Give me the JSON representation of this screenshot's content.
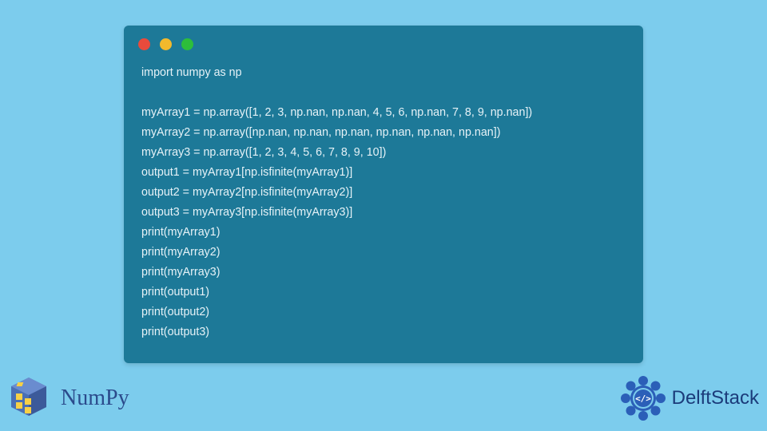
{
  "code": {
    "line1": "import numpy as np",
    "blank": "",
    "line2": "myArray1 = np.array([1, 2, 3, np.nan, np.nan, 4, 5, 6, np.nan, 7, 8, 9, np.nan])",
    "line3": "myArray2 = np.array([np.nan, np.nan, np.nan, np.nan, np.nan, np.nan])",
    "line4": "myArray3 = np.array([1, 2, 3, 4, 5, 6, 7, 8, 9, 10])",
    "line5": "output1 = myArray1[np.isfinite(myArray1)]",
    "line6": "output2 = myArray2[np.isfinite(myArray2)]",
    "line7": "output3 = myArray3[np.isfinite(myArray3)]",
    "line8": "print(myArray1)",
    "line9": "print(myArray2)",
    "line10": "print(myArray3)",
    "line11": "print(output1)",
    "line12": "print(output2)",
    "line13": "print(output3)"
  },
  "logos": {
    "numpy": "NumPy",
    "delft": "DelftStack"
  }
}
